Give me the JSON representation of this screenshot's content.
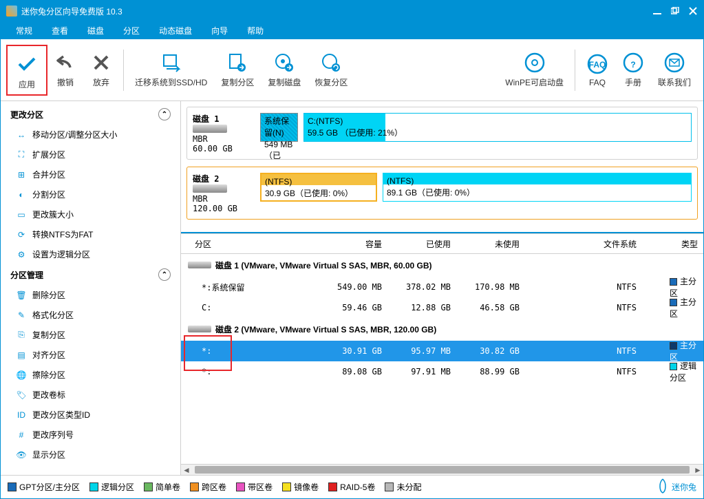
{
  "title": "迷你兔分区向导免费版 10.3",
  "menu": [
    "常规",
    "查看",
    "磁盘",
    "分区",
    "动态磁盘",
    "向导",
    "帮助"
  ],
  "toolbar": {
    "apply": "应用",
    "undo": "撤销",
    "discard": "放弃",
    "migrate": "迁移系统到SSD/HD",
    "copypart": "复制分区",
    "copydisk": "复制磁盘",
    "recover": "恢复分区",
    "winpe": "WinPE可启动盘",
    "faq": "FAQ",
    "manual": "手册",
    "contact": "联系我们"
  },
  "sidebar": {
    "section1": "更改分区",
    "s1items": [
      "移动分区/调整分区大小",
      "扩展分区",
      "合并分区",
      "分割分区",
      "更改簇大小",
      "转换NTFS为FAT",
      "设置为逻辑分区"
    ],
    "section2": "分区管理",
    "s2items": [
      "删除分区",
      "格式化分区",
      "复制分区",
      "对齐分区",
      "擦除分区",
      "更改卷标",
      "更改分区类型ID",
      "更改序列号",
      "显示分区"
    ]
  },
  "disks": {
    "d1": {
      "name": "磁盘 1",
      "scheme": "MBR",
      "size": "60.00 GB",
      "p1": {
        "t1": "系统保留(N)",
        "t2": "549 MB （已"
      },
      "p2": {
        "t1": "C:(NTFS)",
        "t2": "59.5 GB （已使用:  21%）"
      }
    },
    "d2": {
      "name": "磁盘 2",
      "scheme": "MBR",
      "size": "120.00 GB",
      "p1": {
        "t1": "(NTFS)",
        "t2": "30.9 GB（已使用:  0%）"
      },
      "p2": {
        "t1": "(NTFS)",
        "t2": "89.1 GB（已使用:  0%）"
      }
    }
  },
  "table": {
    "headers": {
      "name": "分区",
      "cap": "容量",
      "used": "已使用",
      "free": "未使用",
      "fs": "文件系统",
      "type": "类型"
    },
    "disk1hdr": "磁盘 1 (VMware, VMware Virtual S SAS, MBR, 60.00 GB)",
    "disk2hdr": "磁盘 2 (VMware, VMware Virtual S SAS, MBR, 120.00 GB)",
    "rows": [
      {
        "name": "*:系统保留",
        "cap": "549.00 MB",
        "used": "378.02 MB",
        "free": "170.98 MB",
        "fs": "NTFS",
        "type": "主分区",
        "sw": "#1a6bb8"
      },
      {
        "name": "C:",
        "cap": "59.46 GB",
        "used": "12.88 GB",
        "free": "46.58 GB",
        "fs": "NTFS",
        "type": "主分区",
        "sw": "#1a6bb8"
      }
    ],
    "rows2": [
      {
        "name": "*:",
        "cap": "30.91 GB",
        "used": "95.97 MB",
        "free": "30.82 GB",
        "fs": "NTFS",
        "type": "主分区",
        "sw": "#0d3a6b",
        "sel": true
      },
      {
        "name": "*:",
        "cap": "89.08 GB",
        "used": "97.91 MB",
        "free": "88.99 GB",
        "fs": "NTFS",
        "type": "逻辑分区",
        "sw": "#00d4e8"
      }
    ]
  },
  "legend": [
    {
      "label": "GPT分区/主分区",
      "c": "#1a6bb8"
    },
    {
      "label": "逻辑分区",
      "c": "#00d4e8"
    },
    {
      "label": "简单卷",
      "c": "#6ab860"
    },
    {
      "label": "跨区卷",
      "c": "#f09020"
    },
    {
      "label": "带区卷",
      "c": "#e854c0"
    },
    {
      "label": "镜像卷",
      "c": "#f5e020"
    },
    {
      "label": "RAID-5卷",
      "c": "#e02020"
    },
    {
      "label": "未分配",
      "c": "#b8b8b8"
    }
  ],
  "brand": "迷你兔"
}
